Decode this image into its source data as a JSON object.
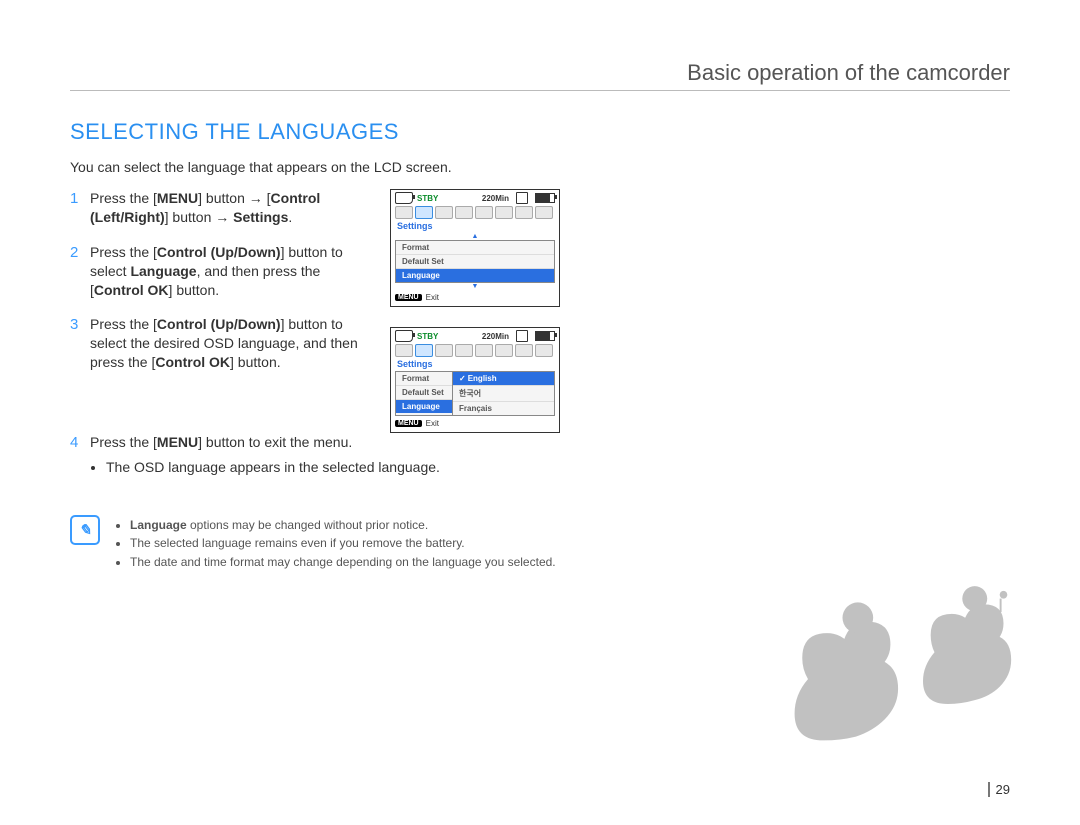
{
  "chapter_title": "Basic operation of the camcorder",
  "section_title": "SELECTING THE LANGUAGES",
  "intro": "You can select the language that appears on the LCD screen.",
  "steps": {
    "s1": {
      "pre": "Press the [",
      "b1": "MENU",
      "mid1": "] button → [",
      "b2": "Control (Left/Right)",
      "mid2": "] button → ",
      "b3": "Settings",
      "post": "."
    },
    "s2": {
      "pre": "Press the [",
      "b1": "Control (Up/Down)",
      "mid1": "] button to select ",
      "b2": "Language",
      "mid2": ", and then press the [",
      "b3": "Control OK",
      "post": "] button."
    },
    "s3": {
      "pre": "Press the [",
      "b1": "Control (Up/Down)",
      "mid1": "] button to select the desired OSD language, and then press the [",
      "b2": "Control OK",
      "post": "] button."
    },
    "s4": {
      "pre": "Press the [",
      "b1": "MENU",
      "post": "] button to exit the menu.",
      "bullet1": "The OSD language appears in the selected language."
    }
  },
  "notes": {
    "n1_pre": "",
    "n1_b": "Language",
    "n1_post": " options may be changed without prior notice.",
    "n2": "The selected language remains even if you remove the battery.",
    "n3": "The date and time format may change depending on the language you selected."
  },
  "lcd": {
    "stby": "STBY",
    "time": "220Min",
    "settings": "Settings",
    "format": "Format",
    "default_set": "Default Set",
    "language": "Language",
    "menu_label": "MENU",
    "exit": "Exit",
    "english": "English",
    "korean": "한국어",
    "french": "Français"
  },
  "page_number": "29"
}
